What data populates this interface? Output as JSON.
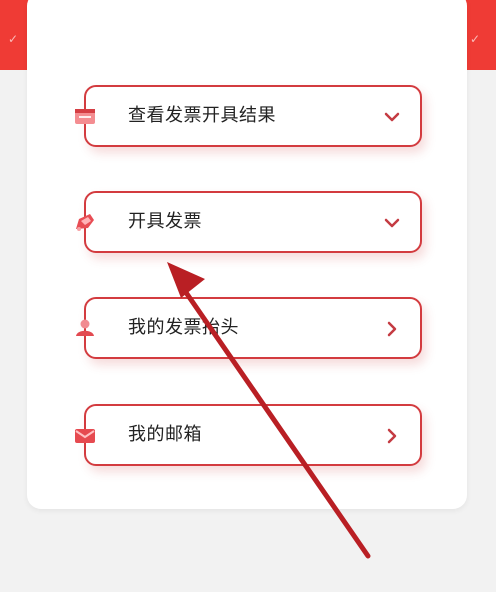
{
  "theme": {
    "accent": "#ef3b35",
    "border": "#d33b3f",
    "arrow": "#bf1f24"
  },
  "menu": {
    "items": [
      {
        "label": "查看发票开具结果",
        "icon": "invoice-result-icon",
        "indicator": "chevron-down-icon"
      },
      {
        "label": "开具发票",
        "icon": "issue-invoice-icon",
        "indicator": "chevron-down-icon"
      },
      {
        "label": "我的发票抬头",
        "icon": "invoice-title-icon",
        "indicator": "chevron-right-icon"
      },
      {
        "label": "我的邮箱",
        "icon": "mailbox-icon",
        "indicator": "chevron-right-icon"
      }
    ]
  }
}
